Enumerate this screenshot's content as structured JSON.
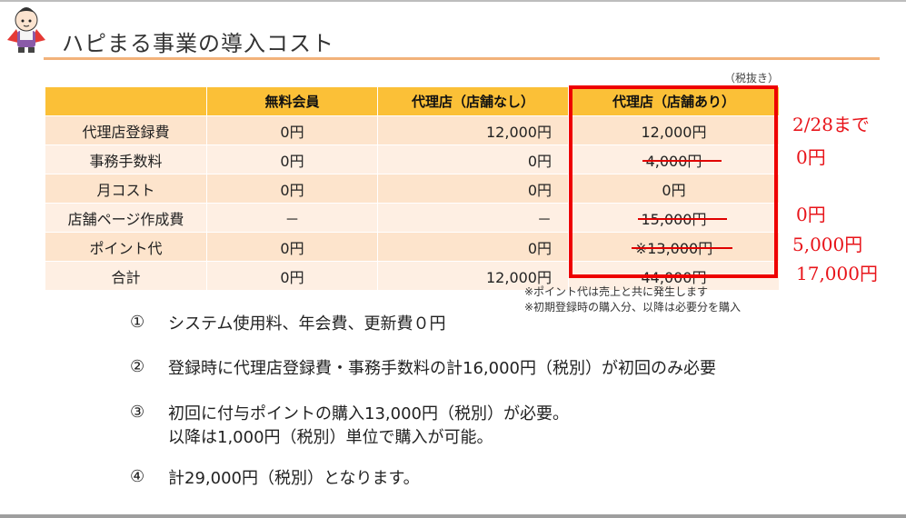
{
  "title": "ハピまる事業の導入コスト",
  "tax_note": "（税抜き）",
  "table": {
    "headers": [
      "",
      "無料会員",
      "代理店（店舗なし）",
      "代理店（店舗あり）"
    ],
    "rows": [
      {
        "label": "代理店登録費",
        "c1": "0円",
        "c2": "12,000円",
        "c3": "12,000円"
      },
      {
        "label": "事務手数料",
        "c1": "0円",
        "c2": "0円",
        "c3": "4,000円"
      },
      {
        "label": "月コスト",
        "c1": "0円",
        "c2": "0円",
        "c3": "0円"
      },
      {
        "label": "店舗ページ作成費",
        "c1": "－",
        "c2": "－",
        "c3": "15,000円"
      },
      {
        "label": "ポイント代",
        "c1": "0円",
        "c2": "0円",
        "c3": "※13,000円"
      },
      {
        "label": "合計",
        "c1": "0円",
        "c2": "12,000円",
        "c3": "44,000円"
      }
    ]
  },
  "annotations": {
    "registration": "2/28まで",
    "fee": "0円",
    "page": "0円",
    "points": "5,000円",
    "total": "17,000円"
  },
  "footnotes": [
    "※ポイント代は売上と共に発生します",
    "※初期登録時の購入分、以降は必要分を購入"
  ],
  "items": [
    {
      "num": "①",
      "lines": [
        "システム使用料、年会費、更新費０円"
      ]
    },
    {
      "num": "②",
      "lines": [
        "登録時に代理店登録費・事務手数料の計16,000円（税別）が初回のみ必要"
      ]
    },
    {
      "num": "③",
      "lines": [
        "初回に付与ポイントの購入13,000円（税別）が必要。",
        "以降は1,000円（税別）単位で購入が可能。"
      ]
    },
    {
      "num": "④",
      "lines": [
        "計29,000円（税別）となります。"
      ]
    }
  ],
  "colors": {
    "header": "#fbc037",
    "row_odd": "#fde4cc",
    "row_even": "#feefe3",
    "highlight": "#ee0000",
    "rule": "#f2b27a"
  }
}
